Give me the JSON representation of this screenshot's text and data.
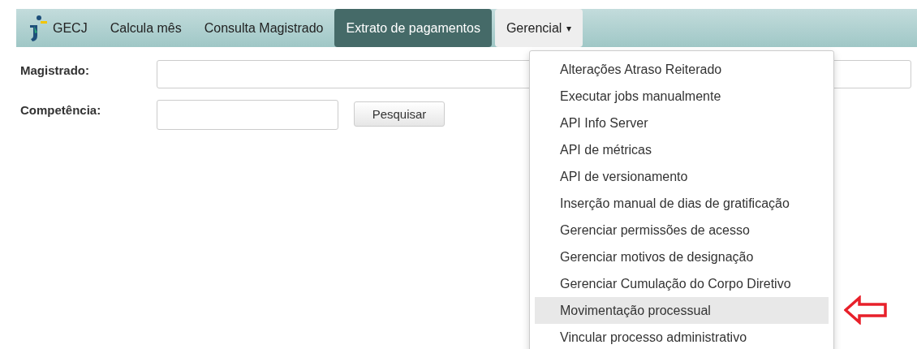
{
  "navbar": {
    "brand": "GECJ",
    "items": [
      {
        "label": "Calcula mês",
        "selected": false
      },
      {
        "label": "Consulta Magistrado",
        "selected": false
      },
      {
        "label": "Extrato de pagamentos",
        "selected": true
      }
    ],
    "dropdown": {
      "label": "Gerencial",
      "expanded": true,
      "caret": "▾"
    }
  },
  "form": {
    "fields": [
      {
        "label": "Magistrado:",
        "kind": "wide"
      },
      {
        "label": "Competência:",
        "kind": "short"
      }
    ],
    "search_button": "Pesquisar"
  },
  "menu": [
    {
      "label": "Alterações Atraso Reiterado",
      "selected": false
    },
    {
      "label": "Executar jobs manualmente",
      "selected": false
    },
    {
      "label": "API Info Server",
      "selected": false
    },
    {
      "label": "API de métricas",
      "selected": false
    },
    {
      "label": "API de versionamento",
      "selected": false
    },
    {
      "label": "Inserção manual de dias de gratificação",
      "selected": false
    },
    {
      "label": "Gerenciar permissões de acesso",
      "selected": false
    },
    {
      "label": "Gerenciar motivos de designação",
      "selected": false
    },
    {
      "label": "Gerenciar Cumulação do Corpo Diretivo",
      "selected": false
    },
    {
      "label": "Movimentação processual",
      "selected": true
    },
    {
      "label": "Vincular processo administrativo",
      "selected": false
    }
  ]
}
